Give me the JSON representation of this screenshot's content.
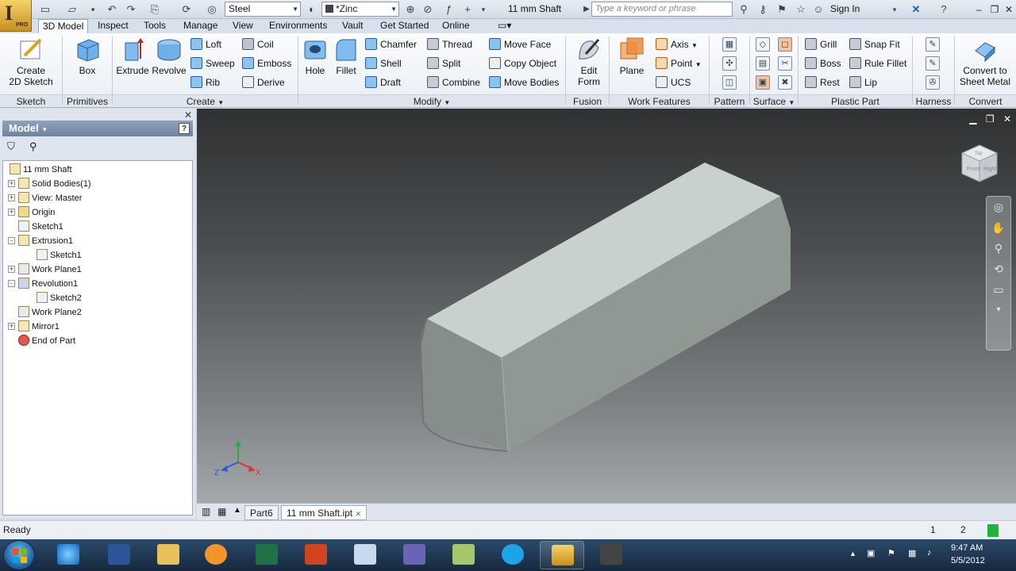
{
  "titlebar": {
    "material": "Steel",
    "appearance": "*Zinc",
    "document_title": "11 mm Shaft",
    "search_placeholder": "Type a keyword or phrase",
    "sign_in": "Sign In"
  },
  "tabs": [
    "3D Model",
    "Inspect",
    "Tools",
    "Manage",
    "View",
    "Environments",
    "Vault",
    "Get Started",
    "Online"
  ],
  "ribbon": {
    "sketch": {
      "create_2d_sketch": "Create\n2D Sketch",
      "title": "Sketch"
    },
    "primitives": {
      "box": "Box",
      "title": "Primitives"
    },
    "create": {
      "extrude": "Extrude",
      "revolve": "Revolve",
      "loft": "Loft",
      "sweep": "Sweep",
      "rib": "Rib",
      "coil": "Coil",
      "emboss": "Emboss",
      "derive": "Derive",
      "title": "Create"
    },
    "modify": {
      "hole": "Hole",
      "fillet": "Fillet",
      "chamfer": "Chamfer",
      "shell": "Shell",
      "draft": "Draft",
      "thread": "Thread",
      "split": "Split",
      "combine": "Combine",
      "move_face": "Move Face",
      "copy_object": "Copy Object",
      "move_bodies": "Move Bodies",
      "title": "Modify"
    },
    "fusion": {
      "edit_form": "Edit\nForm",
      "title": "Fusion"
    },
    "work_features": {
      "plane": "Plane",
      "axis": "Axis",
      "point": "Point",
      "ucs": "UCS",
      "title": "Work Features"
    },
    "pattern": {
      "title": "Pattern"
    },
    "surface": {
      "title": "Surface"
    },
    "plastic_part": {
      "grill": "Grill",
      "boss": "Boss",
      "rest": "Rest",
      "snap_fit": "Snap Fit",
      "rule_fillet": "Rule Fillet",
      "lip": "Lip",
      "title": "Plastic Part"
    },
    "harness": {
      "title": "Harness"
    },
    "convert": {
      "to_sheet_metal": "Convert to\nSheet Metal",
      "title": "Convert"
    }
  },
  "browser": {
    "title": "Model",
    "help": "?",
    "nodes": [
      {
        "label": "11 mm Shaft",
        "indent": 0,
        "expander": ""
      },
      {
        "label": "Solid Bodies(1)",
        "indent": 1,
        "expander": "+"
      },
      {
        "label": "View: Master",
        "indent": 1,
        "expander": "+"
      },
      {
        "label": "Origin",
        "indent": 1,
        "expander": "+"
      },
      {
        "label": "Sketch1",
        "indent": 1,
        "expander": ""
      },
      {
        "label": "Extrusion1",
        "indent": 1,
        "expander": "-"
      },
      {
        "label": "Sketch1",
        "indent": 2,
        "expander": ""
      },
      {
        "label": "Work Plane1",
        "indent": 1,
        "expander": "+"
      },
      {
        "label": "Revolution1",
        "indent": 1,
        "expander": "-"
      },
      {
        "label": "Sketch2",
        "indent": 2,
        "expander": ""
      },
      {
        "label": "Work Plane2",
        "indent": 1,
        "expander": ""
      },
      {
        "label": "Mirror1",
        "indent": 1,
        "expander": "+"
      },
      {
        "label": "End of Part",
        "indent": 1,
        "expander": ""
      }
    ]
  },
  "viewcube": {
    "faces": [
      "Front",
      "Right",
      "Top"
    ]
  },
  "doc_tabs": [
    "Part6",
    "11 mm Shaft.ipt"
  ],
  "status": {
    "text": "Ready",
    "count_a": "1",
    "count_b": "2"
  },
  "clock": {
    "time": "9:47 AM",
    "date": "5/5/2012"
  },
  "colors": {
    "accent": "#2f6fbf",
    "ribbon_bg": "#f3f6fa",
    "model_face": "#c7d0cc"
  }
}
